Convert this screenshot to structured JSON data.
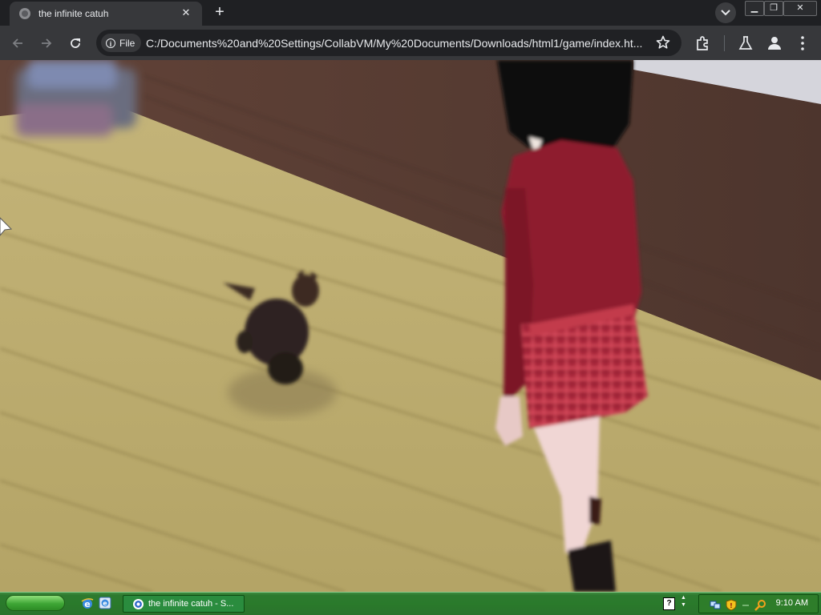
{
  "browser": {
    "tab_title": "the infinite catuh",
    "tab_close": "✕",
    "new_tab": "+",
    "address_chip": "File",
    "url": "C:/Documents%20and%20Settings/CollabVM/My%20Documents/Downloads/html1/game/index.ht...",
    "window_controls": {
      "minimize": "▁",
      "restore": "❐",
      "close": "✕"
    }
  },
  "icons": {
    "back": "arrow-left-icon",
    "forward": "arrow-right-icon",
    "reload": "reload-icon",
    "bookmark": "star-icon",
    "extensions": "puzzle-icon",
    "labs": "flask-icon",
    "profile": "person-icon",
    "menu": "kebab-menu-icon"
  },
  "taskbar": {
    "task_label": "the infinite catuh - S...",
    "help": "?",
    "clock": "9:10 AM"
  },
  "colors": {
    "floor": "#b7a868",
    "wall": "#5a4036",
    "dress": "#8e1f2e",
    "skirt_plaid": "#c4394a",
    "taskbar_green": "#2a7a2b"
  }
}
